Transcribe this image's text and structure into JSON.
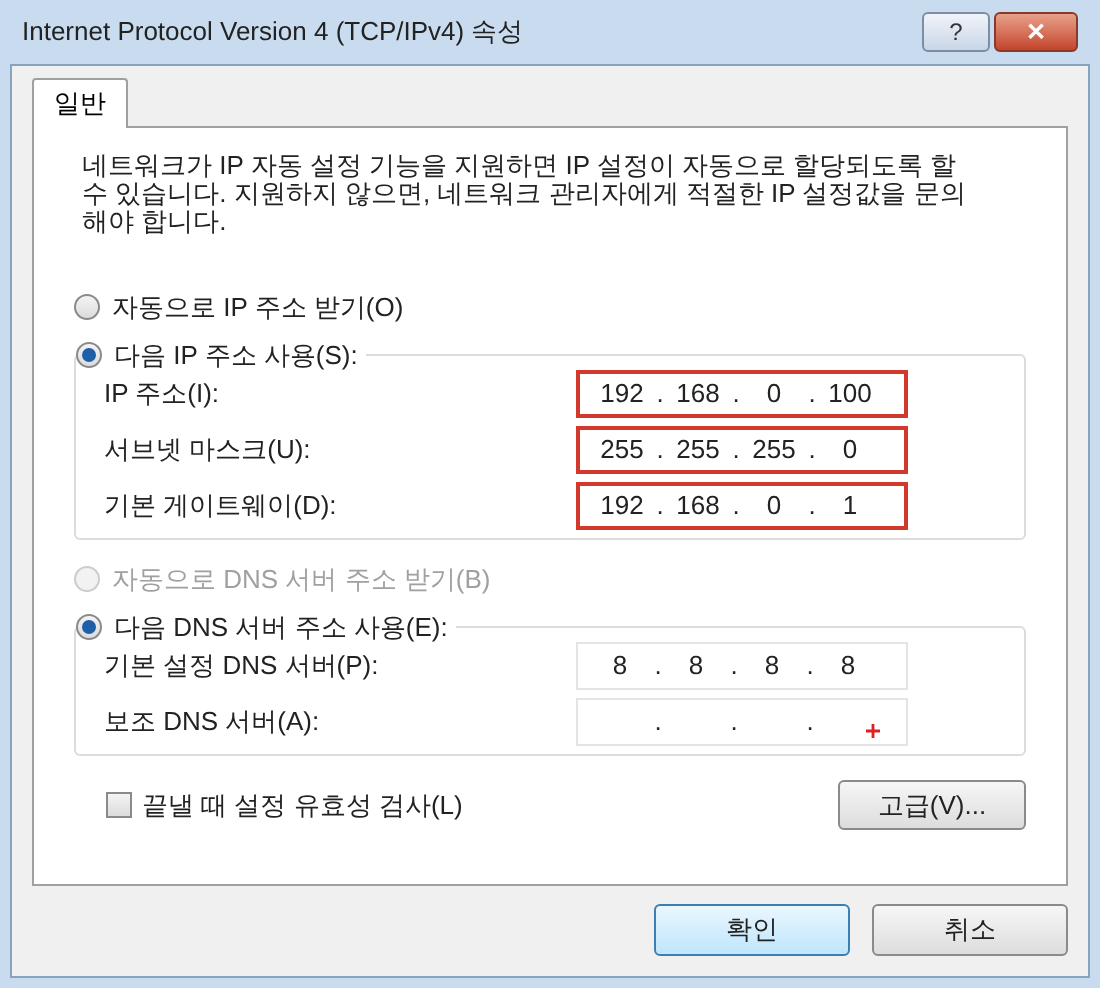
{
  "window": {
    "title": "Internet Protocol Version 4 (TCP/IPv4) 속성",
    "buttons": [
      {
        "kind": "help",
        "label": "?"
      },
      {
        "kind": "close",
        "label": "✕"
      }
    ]
  },
  "tabs": [
    {
      "label": "일반",
      "selected": true
    }
  ],
  "description": "네트워크가 IP 자동 설정 기능을 지원하면 IP 설정이 자동으로 할당되도록 할 수 있습니다. 지원하지 않으면, 네트워크 관리자에게 적절한 IP 설정값을 문의해야 합니다.",
  "groups": [
    {
      "auto_option": {
        "label": "자동으로 IP 주소 받기(O)",
        "selected": false,
        "disabled": false
      },
      "manual_option": {
        "label": "다음 IP 주소 사용(S):",
        "selected": true,
        "disabled": false
      },
      "fields": [
        {
          "label": "IP 주소(I):",
          "octets": [
            "192",
            "168",
            "0",
            "100"
          ],
          "separators": [
            ".",
            ".",
            "."
          ],
          "highlighted": true
        },
        {
          "label": "서브넷 마스크(U):",
          "octets": [
            "255",
            "255",
            "255",
            "0"
          ],
          "separators": [
            ".",
            ".",
            "."
          ],
          "highlighted": true
        },
        {
          "label": "기본 게이트웨이(D):",
          "octets": [
            "192",
            "168",
            "0",
            "1"
          ],
          "separators": [
            ".",
            ".",
            "."
          ],
          "highlighted": true
        }
      ]
    },
    {
      "auto_option": {
        "label": "자동으로 DNS 서버 주소 받기(B)",
        "selected": false,
        "disabled": true
      },
      "manual_option": {
        "label": "다음 DNS 서버 주소 사용(E):",
        "selected": true,
        "disabled": false
      },
      "fields": [
        {
          "label": "기본 설정 DNS 서버(P):",
          "octets": [
            "8",
            "8",
            "8",
            "8"
          ],
          "separators": [
            ".",
            ".",
            "."
          ],
          "highlighted": false
        },
        {
          "label": "보조 DNS 서버(A):",
          "separators": [
            ".",
            ".",
            "."
          ],
          "highlighted": false
        }
      ]
    }
  ],
  "validate_checkbox": {
    "label": "끝낼 때 설정 유효성 검사(L)",
    "checked": false
  },
  "advanced_button": "고급(V)...",
  "footer_buttons": [
    {
      "label": "확인",
      "default": true
    },
    {
      "label": "취소",
      "default": false
    }
  ]
}
